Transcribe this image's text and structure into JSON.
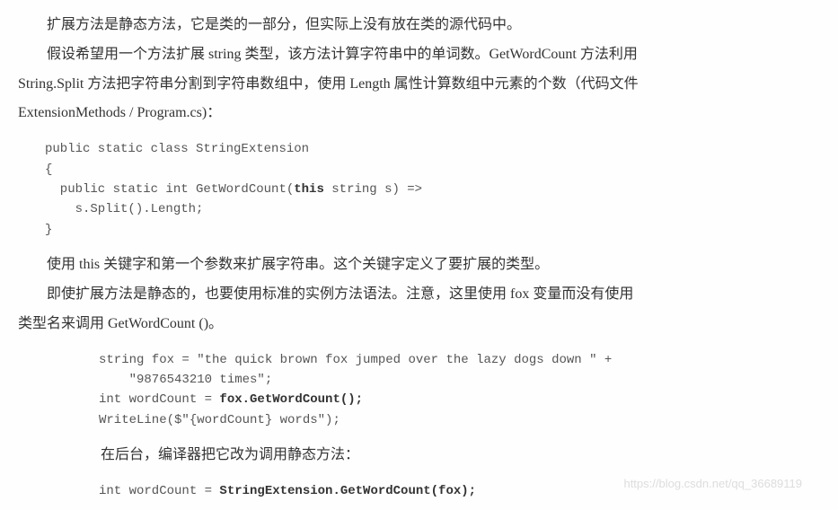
{
  "para1": "扩展方法是静态方法，它是类的一部分，但实际上没有放在类的源代码中。",
  "para2": "假设希望用一个方法扩展 string 类型，该方法计算字符串中的单词数。GetWordCount 方法利用",
  "para2b": "String.Split 方法把字符串分割到字符串数组中，使用 Length 属性计算数组中元素的个数（代码文件",
  "para2c": "ExtensionMethods / Program.cs)：",
  "code1_l1": "public static class StringExtension",
  "code1_l2": "{",
  "code1_l3": "  public static int GetWordCount(",
  "code1_l3b": "this",
  "code1_l3c": " string s) =>",
  "code1_l4": "    s.Split().Length;",
  "code1_l5": "}",
  "para3": "使用 this 关键字和第一个参数来扩展字符串。这个关键字定义了要扩展的类型。",
  "para4": "即使扩展方法是静态的，也要使用标准的实例方法语法。注意，这里使用 fox 变量而没有使用",
  "para4b": "类型名来调用 GetWordCount ()。",
  "code2_l1": "string fox = \"the quick brown fox jumped over the lazy dogs down \" +",
  "code2_l2": "    \"9876543210 times\";",
  "code2_l3a": "int wordCount = ",
  "code2_l3b": "fox.GetWordCount();",
  "code2_l4": "WriteLine($\"{wordCount} words\");",
  "para5": "在后台，编译器把它改为调用静态方法：",
  "code3_l1a": "int wordCount = ",
  "code3_l1b": "StringExtension.GetWordCount(fox);",
  "watermark": "https://blog.csdn.net/qq_36689119"
}
